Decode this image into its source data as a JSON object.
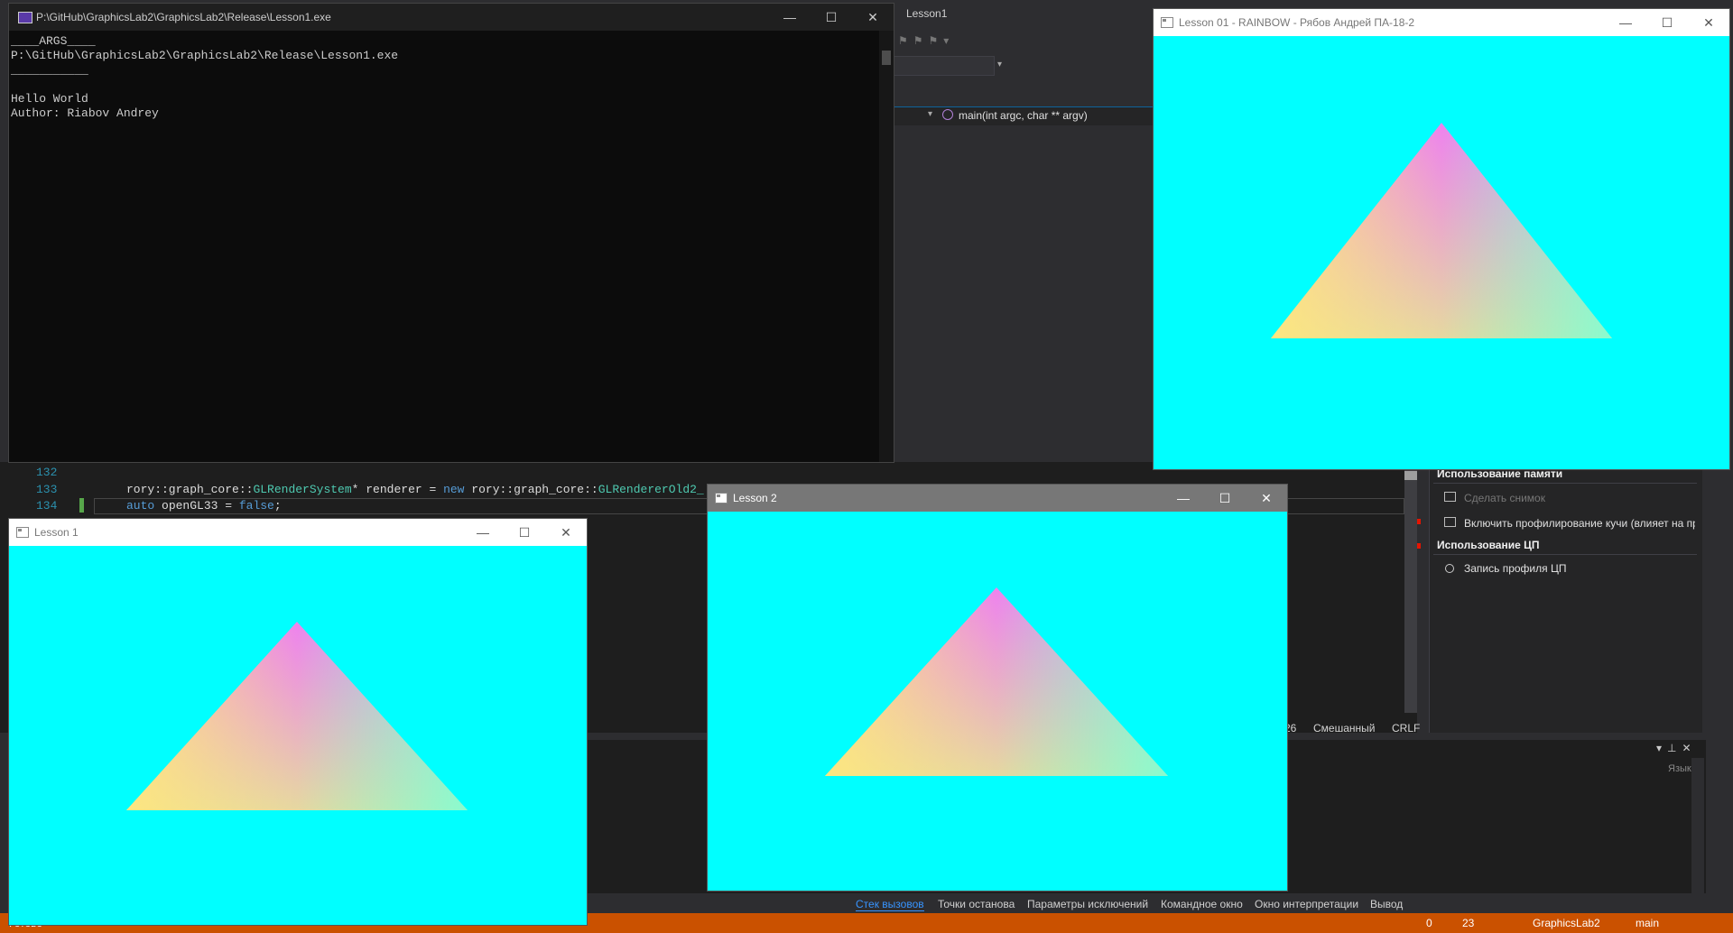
{
  "vs": {
    "doc_tab": "Lesson1",
    "nav_function": "main(int argc, char ** argv)",
    "code": {
      "lines": [
        {
          "num": "132",
          "text": ""
        },
        {
          "num": "133",
          "pre": "rory::graph_core::",
          "type1": "GLRenderSystem",
          "mid": "* renderer = ",
          "kw": "new",
          "post": " rory::graph_core::",
          "type2": "GLRendererOld2_"
        },
        {
          "num": "134",
          "kw1": "auto",
          "mid": " openGL33 = ",
          "kw2": "false",
          "end": ";"
        }
      ]
    },
    "status_right": {
      "pos": "26",
      "encoding": "Смешанный",
      "eol": "CRLF"
    },
    "diagnostics": {
      "memory_header": "Использование памяти",
      "snapshot": "Сделать снимок",
      "heap_profiling": "Включить профилирование кучи (влияет на пр",
      "cpu_header": "Использование ЦП",
      "cpu_record": "Запись профиля ЦП"
    },
    "output_lang": "Язык",
    "bottom_tabs": [
      "Стек вызовов",
      "Точки останова",
      "Параметры исключений",
      "Командное окно",
      "Окно интерпретации",
      "Вывод"
    ],
    "statusbar": {
      "left": "Готово",
      "errors": "0",
      "warnings": "23",
      "repo": "GraphicsLab2",
      "branch": "main"
    }
  },
  "console": {
    "title": "P:\\GitHub\\GraphicsLab2\\GraphicsLab2\\Release\\Lesson1.exe",
    "lines": [
      "____ARGS____",
      "P:\\GitHub\\GraphicsLab2\\GraphicsLab2\\Release\\Lesson1.exe",
      "___________",
      "",
      "Hello World",
      "Author: Riabov Andrey"
    ]
  },
  "windows": {
    "rainbow_title": "Lesson 01 - RAINBOW - Рябов Андрей ПА-18-2",
    "lesson1_title": "Lesson 1",
    "lesson2_title": "Lesson 2"
  },
  "colors": {
    "gl_clear": "#00ffff",
    "tri_top": "#ee82ee",
    "tri_left": "#ffe87c",
    "tri_right": "#7fffd4",
    "statusbar": "#ca5100",
    "accent": "#0e639c"
  },
  "icons": {
    "minimize": "—",
    "maximize": "☐",
    "close": "✕"
  }
}
